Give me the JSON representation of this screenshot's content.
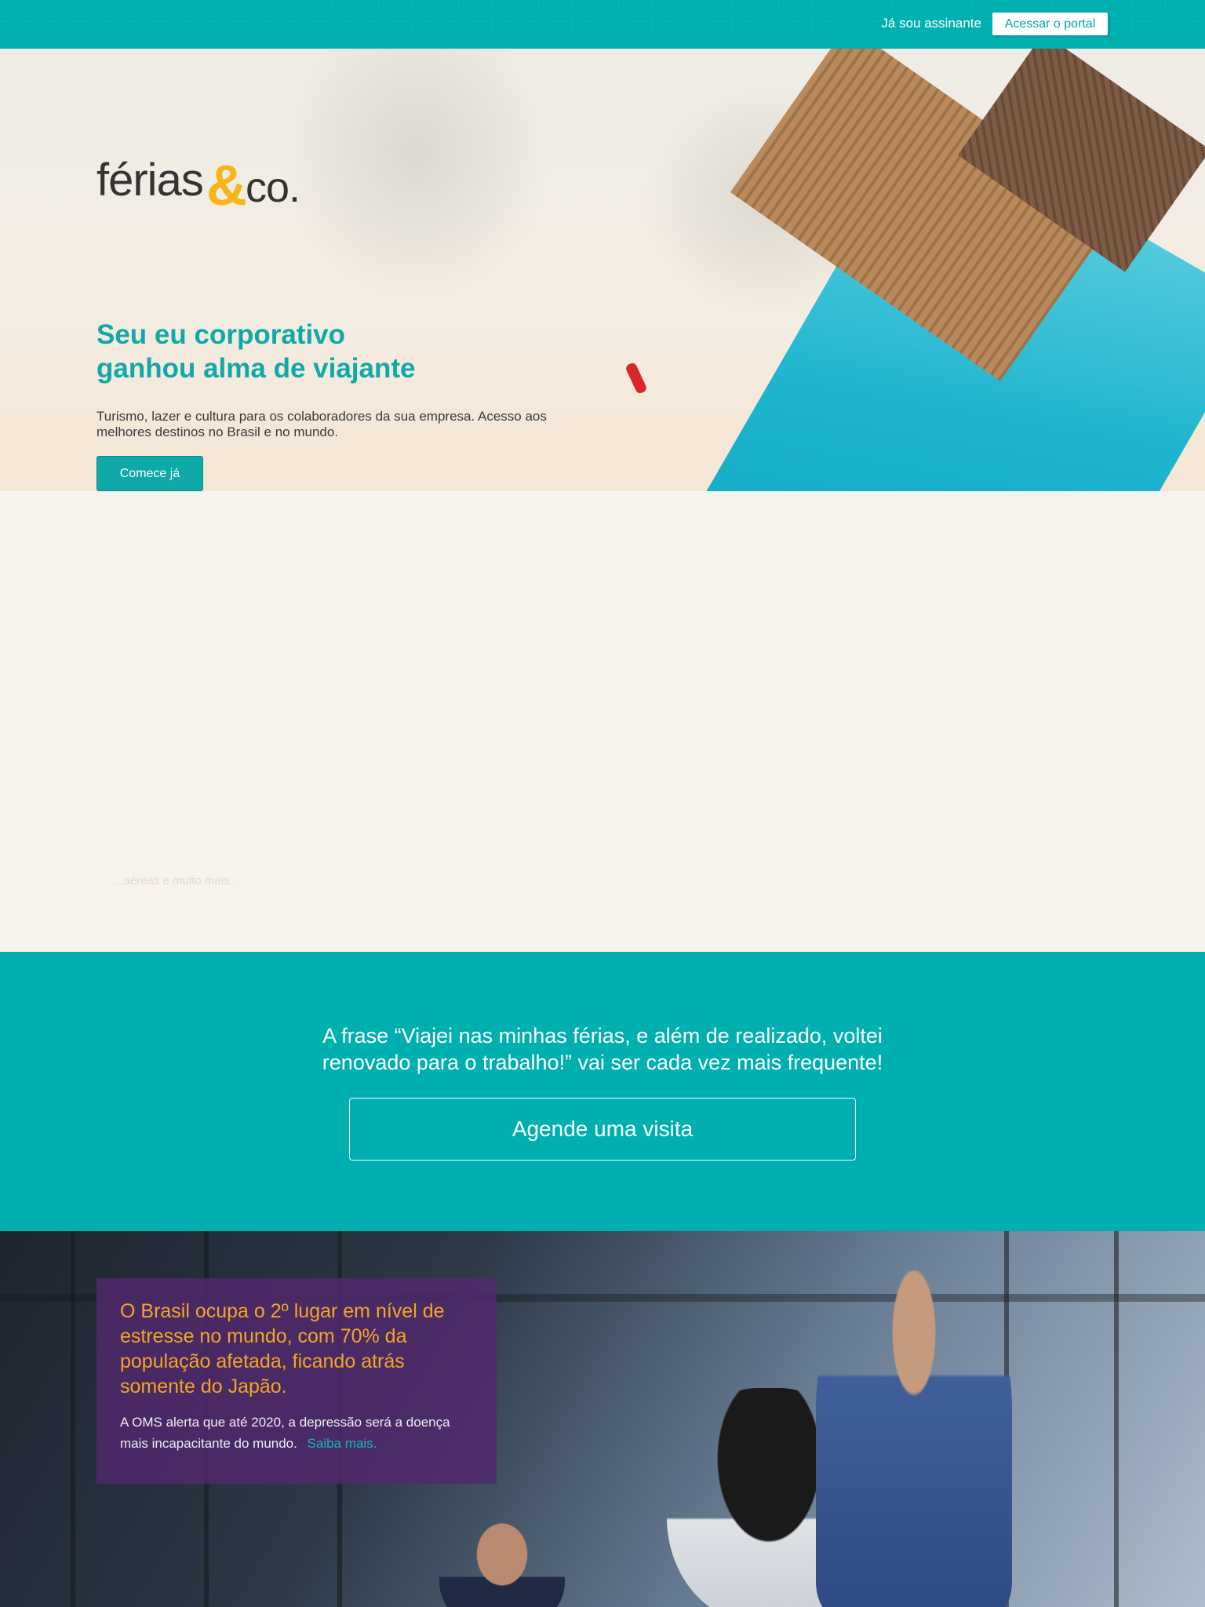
{
  "topbar": {
    "already_subscriber": "Já sou assinante",
    "portal_button": "Acessar o portal"
  },
  "hero": {
    "logo": {
      "part1": "férias",
      "amp": "&",
      "part2": "co."
    },
    "title_line1": "Seu eu corporativo",
    "title_line2": "ganhou alma de viajante",
    "description": "Turismo, lazer e cultura para os colaboradores da sua empresa. Acesso aos melhores destinos no Brasil e no mundo.",
    "cta_button": "Comece já"
  },
  "benefits": {
    "faded_text": "...aéreas e muito mais."
  },
  "cta": {
    "quote": "A frase “Viajei nas minhas férias, e além de realizado, voltei renovado para o trabalho!” vai ser cada vez mais frequente!",
    "visit_button": "Agende uma visita"
  },
  "stat": {
    "headline": "O Brasil ocupa o 2º lugar em nível de estresse no mundo, com 70% da população afetada, ficando atrás somente do Japão.",
    "subtext": "A OMS alerta que até 2020, a depressão será a doença mais incapacitante do mundo.",
    "more_link": "Saiba mais."
  },
  "colors": {
    "teal": "#00b0ae",
    "logo_amp": "#f7b518",
    "stat_headline": "#f3a623",
    "stat_box": "#50286e",
    "beige": "#f7f2ec"
  }
}
